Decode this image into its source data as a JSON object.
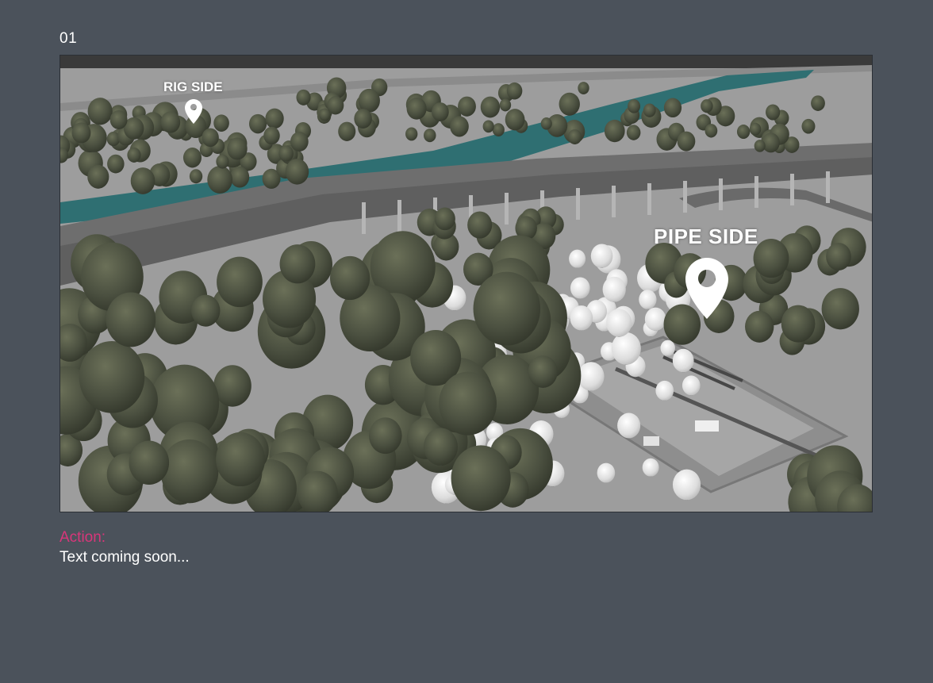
{
  "page": {
    "frame_number": "01"
  },
  "scene": {
    "markers": [
      {
        "label": "RIG SIDE",
        "icon": "map-pin-icon"
      },
      {
        "label": "PIPE SIDE",
        "icon": "map-pin-icon"
      }
    ],
    "colors": {
      "ground": "#9c9c9c",
      "river": "#2f6f72",
      "road": "#6b6b6b",
      "tree_dark": "#4c5140",
      "tree_light": "#e6e6e6"
    }
  },
  "action": {
    "label": "Action:",
    "text": "Text coming soon..."
  }
}
